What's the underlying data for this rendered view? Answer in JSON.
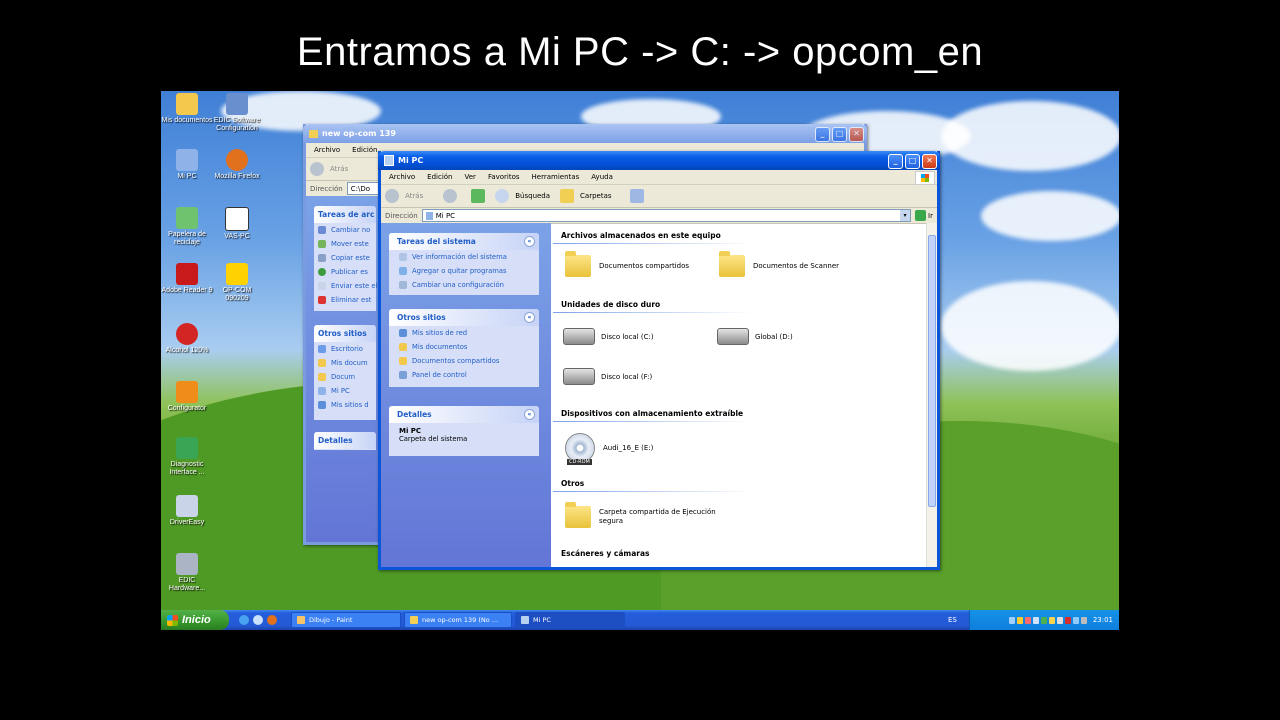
{
  "caption": "Entramos a Mi PC -> C: -> opcom_en",
  "desktop_icons": [
    {
      "label": "Mis documentos",
      "icon": "folder-icon",
      "color": "#f2c94c"
    },
    {
      "label": "EDIC Software Configuration",
      "icon": "network-icon",
      "color": "#6a8fcf"
    },
    {
      "label": "Mi PC",
      "icon": "computer-icon",
      "color": "#8fb3e8"
    },
    {
      "label": "Mozilla Firefox",
      "icon": "firefox-icon",
      "color": "#e2711d"
    },
    {
      "label": "Papelera de reciclaje",
      "icon": "recycle-bin-icon",
      "color": "#6fc36f"
    },
    {
      "label": "VAS-PC",
      "icon": "vas-pc-icon",
      "color": "#ffffff"
    },
    {
      "label": "Adobe Reader 9",
      "icon": "adobe-reader-icon",
      "color": "#c8191b"
    },
    {
      "label": "OP-COM 090209",
      "icon": "opcom-icon",
      "color": "#ffd200"
    },
    {
      "label": "Alcohol 120%",
      "icon": "alcohol-icon",
      "color": "#d42525"
    },
    {
      "label": "Configurator",
      "icon": "configurator-icon",
      "color": "#f08c1a"
    },
    {
      "label": "Diagnostic Interface ...",
      "icon": "diagnostic-icon",
      "color": "#3aa655"
    },
    {
      "label": "DriverEasy",
      "icon": "drivereasy-icon",
      "color": "#c9d4e8"
    },
    {
      "label": "EDIC Hardware...",
      "icon": "edic-hardware-icon",
      "color": "#aab4c4"
    }
  ],
  "back_window": {
    "title": "new op-com 139",
    "menu": [
      "Archivo",
      "Edición"
    ],
    "back_label": "Atrás",
    "address_label": "Dirección",
    "address_value": "C:\\Do",
    "panel_tasks_title": "Tareas de arc",
    "tasks": [
      "Cambiar no",
      "Mover este",
      "Copiar este",
      "Publicar es",
      "Enviar este electrónico",
      "Eliminar est"
    ],
    "panel_others_title": "Otros sitios",
    "others": [
      "Escritorio",
      "Mis docum",
      "Docum",
      "Mi PC",
      "Mis sitios d"
    ],
    "panel_details_title": "Detalles"
  },
  "main_window": {
    "title": "Mi PC",
    "menu": [
      "Archivo",
      "Edición",
      "Ver",
      "Favoritos",
      "Herramientas",
      "Ayuda"
    ],
    "toolbar": {
      "back": "Atrás",
      "search": "Búsqueda",
      "folders": "Carpetas"
    },
    "address_label": "Dirección",
    "address_value": "Mi PC",
    "go_label": "Ir",
    "left": {
      "system_title": "Tareas del sistema",
      "system_items": [
        "Ver información del sistema",
        "Agregar o quitar programas",
        "Cambiar una configuración"
      ],
      "other_title": "Otros sitios",
      "other_items": [
        "Mis sitios de red",
        "Mis documentos",
        "Documentos compartidos",
        "Panel de control"
      ],
      "details_title": "Detalles",
      "details_name": "Mi PC",
      "details_desc": "Carpeta del sistema"
    },
    "groups": {
      "files": "Archivos almacenados en este equipo",
      "hdd": "Unidades de disco duro",
      "removable": "Dispositivos con almacenamiento extraíble",
      "others": "Otros",
      "scanners": "Escáneres y cámaras"
    },
    "items": {
      "shared_docs": "Documentos compartidos",
      "scanner_docs": "Documentos de Scanner",
      "disk_c": "Disco local (C:)",
      "disk_d": "Global (D:)",
      "disk_f": "Disco local (F:)",
      "cd_e": "Audi_16_E (E:)",
      "cd_badge": "CD-ROM",
      "secure_folder": "Carpeta compartida de Ejecución segura"
    }
  },
  "taskbar": {
    "start_label": "Inicio",
    "tasks": [
      "Dibujo - Paint",
      "new op-com 139 (No ...",
      "Mi PC"
    ],
    "language": "ES",
    "clock": "23:01"
  }
}
